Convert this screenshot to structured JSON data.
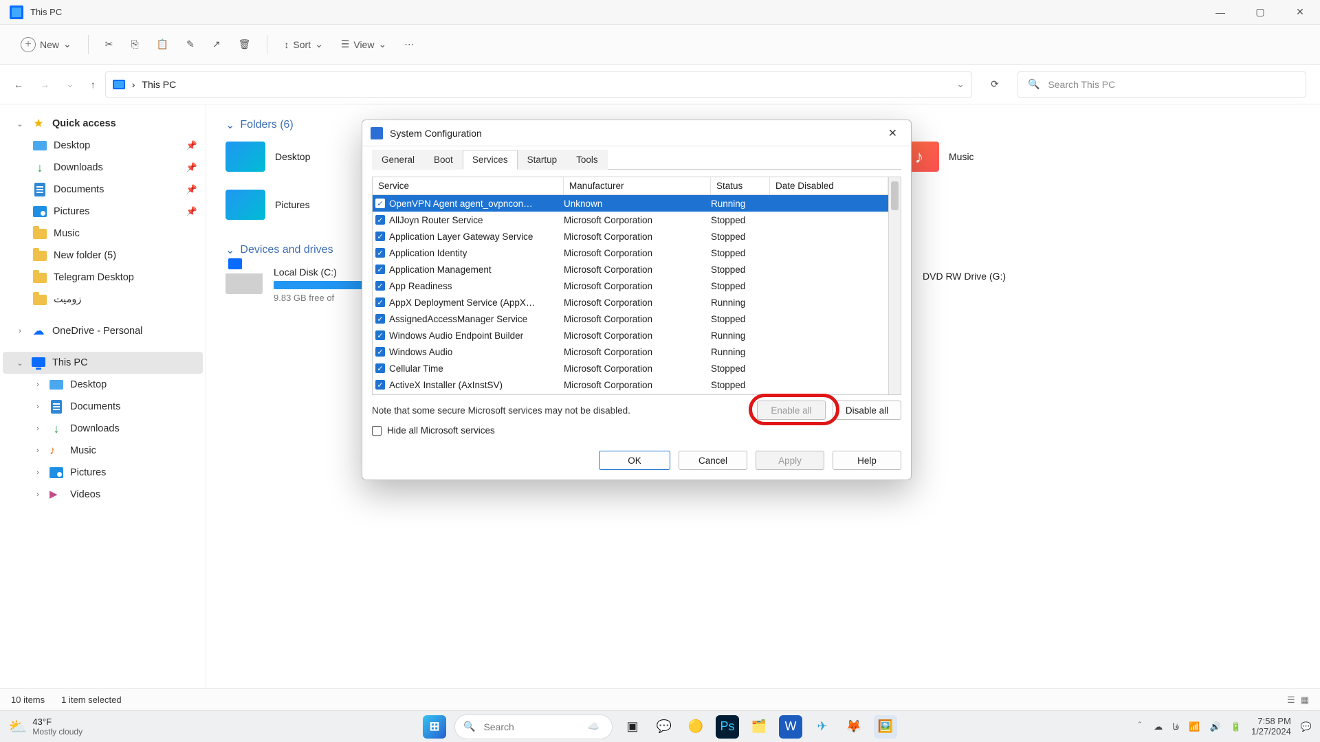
{
  "window": {
    "title": "This PC"
  },
  "toolbar": {
    "new": "New",
    "sort": "Sort",
    "view": "View"
  },
  "address": {
    "crumb": "This PC",
    "search_placeholder": "Search This PC"
  },
  "sidebar": {
    "quick_access": "Quick access",
    "pinned": [
      {
        "label": "Desktop"
      },
      {
        "label": "Downloads"
      },
      {
        "label": "Documents"
      },
      {
        "label": "Pictures"
      },
      {
        "label": "Music"
      },
      {
        "label": "New folder (5)"
      },
      {
        "label": "Telegram Desktop"
      },
      {
        "label": "زومیت"
      }
    ],
    "onedrive": "OneDrive - Personal",
    "this_pc": "This PC",
    "this_pc_children": [
      "Desktop",
      "Documents",
      "Downloads",
      "Music",
      "Pictures",
      "Videos"
    ]
  },
  "content": {
    "folders_header": "Folders (6)",
    "folders": [
      "Desktop",
      "Pictures",
      "Music"
    ],
    "drives_header": "Devices and drives",
    "c_drive": {
      "name": "Local Disk (C:)",
      "free": "9.83 GB free of"
    },
    "dvd": "DVD RW Drive (G:)"
  },
  "statusbar": {
    "items": "10 items",
    "selected": "1 item selected"
  },
  "dialog": {
    "title": "System Configuration",
    "tabs": [
      "General",
      "Boot",
      "Services",
      "Startup",
      "Tools"
    ],
    "active_tab": 2,
    "columns": [
      "Service",
      "Manufacturer",
      "Status",
      "Date Disabled"
    ],
    "rows": [
      {
        "svc": "OpenVPN Agent agent_ovpncon…",
        "mfr": "Unknown",
        "status": "Running",
        "sel": true
      },
      {
        "svc": "AllJoyn Router Service",
        "mfr": "Microsoft Corporation",
        "status": "Stopped"
      },
      {
        "svc": "Application Layer Gateway Service",
        "mfr": "Microsoft Corporation",
        "status": "Stopped"
      },
      {
        "svc": "Application Identity",
        "mfr": "Microsoft Corporation",
        "status": "Stopped"
      },
      {
        "svc": "Application Management",
        "mfr": "Microsoft Corporation",
        "status": "Stopped"
      },
      {
        "svc": "App Readiness",
        "mfr": "Microsoft Corporation",
        "status": "Stopped"
      },
      {
        "svc": "AppX Deployment Service (AppX…",
        "mfr": "Microsoft Corporation",
        "status": "Running"
      },
      {
        "svc": "AssignedAccessManager Service",
        "mfr": "Microsoft Corporation",
        "status": "Stopped"
      },
      {
        "svc": "Windows Audio Endpoint Builder",
        "mfr": "Microsoft Corporation",
        "status": "Running"
      },
      {
        "svc": "Windows Audio",
        "mfr": "Microsoft Corporation",
        "status": "Running"
      },
      {
        "svc": "Cellular Time",
        "mfr": "Microsoft Corporation",
        "status": "Stopped"
      },
      {
        "svc": "ActiveX Installer (AxInstSV)",
        "mfr": "Microsoft Corporation",
        "status": "Stopped"
      }
    ],
    "note": "Note that some secure Microsoft services may not be disabled.",
    "enable_all": "Enable all",
    "disable_all": "Disable all",
    "hide_ms": "Hide all Microsoft services",
    "ok": "OK",
    "cancel": "Cancel",
    "apply": "Apply",
    "help": "Help"
  },
  "taskbar": {
    "temp": "43°F",
    "cond": "Mostly cloudy",
    "search": "Search",
    "lang": "فا",
    "time": "7:58 PM",
    "date": "1/27/2024"
  }
}
